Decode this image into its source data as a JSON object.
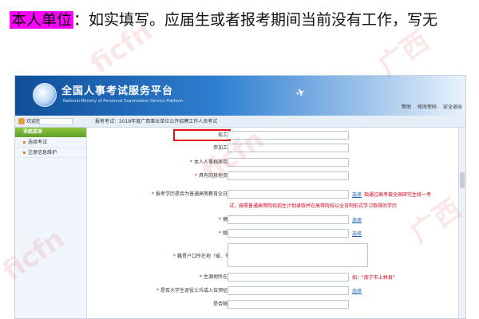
{
  "instruction": {
    "highlight": "本人单位",
    "text": "：如实填写。应届生或者报考期间当前没有工作，写无"
  },
  "watermarks": [
    "ficfn",
    "广西",
    "ficfn",
    "广西",
    "ficfn"
  ],
  "banner": {
    "title": "全国人事考试服务平台",
    "subtitle": "National Ministry of Personnel Examination Service Platform",
    "links": [
      "帮助",
      "修改密码",
      "安全退出"
    ]
  },
  "crumb": {
    "welcome": "欢迎您：",
    "path": "报考考试：2018年度广西事业单位公开招聘工作人员考试"
  },
  "sidebar": {
    "header": "导航菜单",
    "items": [
      "选择考试",
      "注册信息维护"
    ]
  },
  "form": {
    "rows": [
      {
        "label": "现工作单位：",
        "required": false
      },
      {
        "label": "参加工作时间：",
        "required": false
      },
      {
        "label": "本人人事档案存放单位：",
        "required": true
      },
      {
        "label": "具有的其他资格条件：",
        "required": true
      },
      {
        "label": "报考学历是否为普通高等教育全日制学历：",
        "required": true
      },
      {
        "label": "健康状况：",
        "required": true
      },
      {
        "label": "婚姻状况：",
        "required": true
      },
      {
        "label": "籍贯户口所在地（省、市、县）：",
        "required": true
      },
      {
        "label": "生源地所在市、县：",
        "required": true
      },
      {
        "label": "是否大学生退役士兵或入伍预征大学生：",
        "required": true
      },
      {
        "label": "是否随军家属：",
        "required": false
      }
    ],
    "select_link": "选择",
    "notes": {
      "education_1": "指通过高考被全国研究生统一考",
      "education_2": "试，按照普通高等院校招生计划录取并在高等院校以全日制形式学习取得的学历",
      "hometown": "如：\"南宁市上林县\""
    }
  }
}
